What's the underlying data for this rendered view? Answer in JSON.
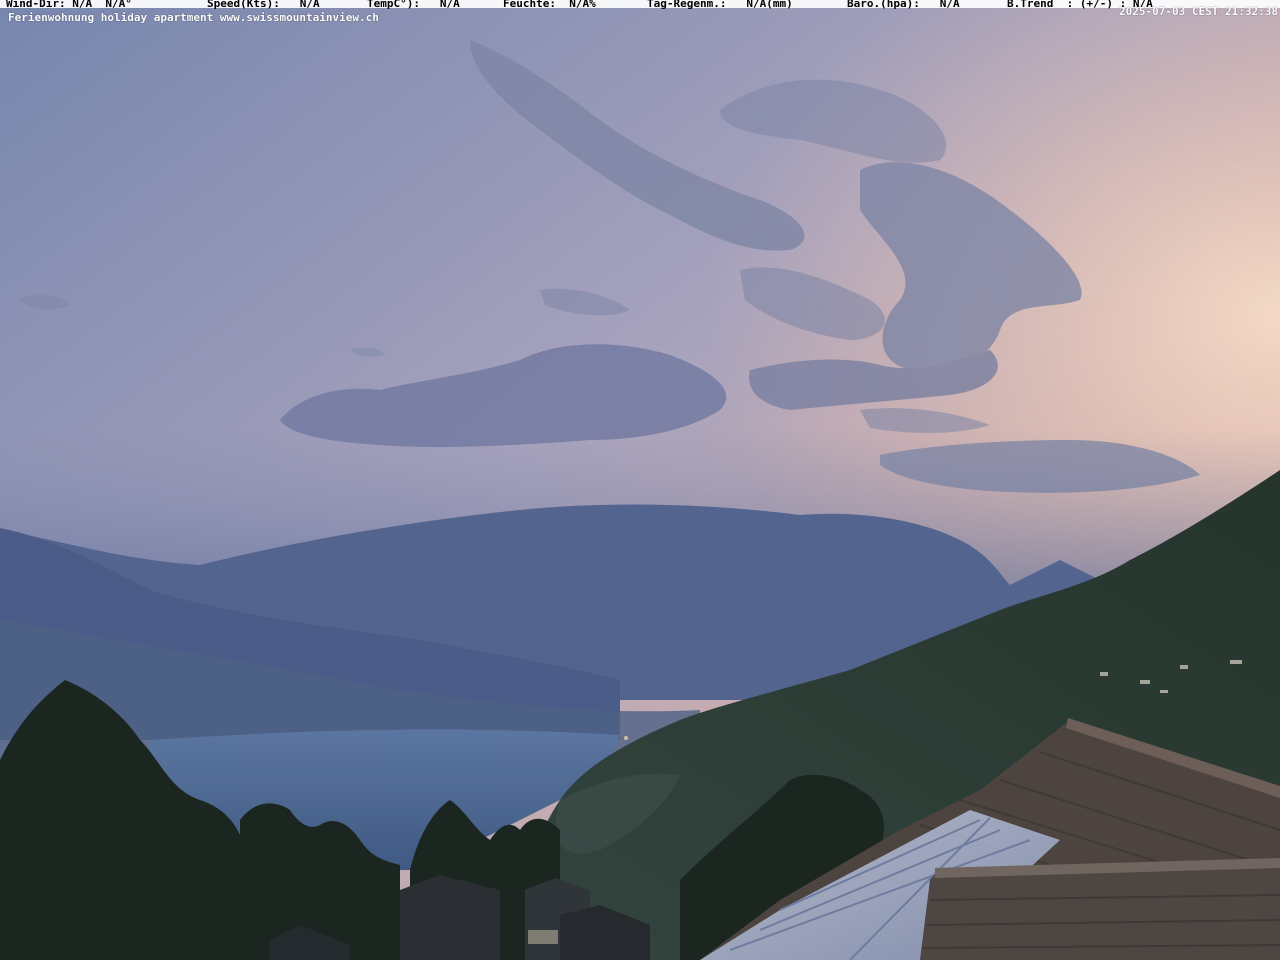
{
  "overlay": {
    "wind_dir": "Wind-Dir: N/A  N/A°",
    "speed": "Speed(Kts):   N/A",
    "temp": "TempC°):   N/A",
    "humidity": "Feuchte:  N/A%",
    "rain": "Tag-Regenm.:   N/A(mm)",
    "baro": "Baro.(hpa):   N/A",
    "trend": "B.Trend  : (+/-) : N/A",
    "timestamp": "2025-07-03 CEST 21:32:38",
    "site": "Ferienwohnung holiday apartment www.swissmountainview.ch"
  },
  "colors": {
    "sky_top": "#7d8cb4",
    "sky_glow": "#e7b7a6",
    "mountains": "#4a5d86",
    "lake": "#4c6a94",
    "hillside": "#26362d",
    "roof": "#5a4b44"
  }
}
